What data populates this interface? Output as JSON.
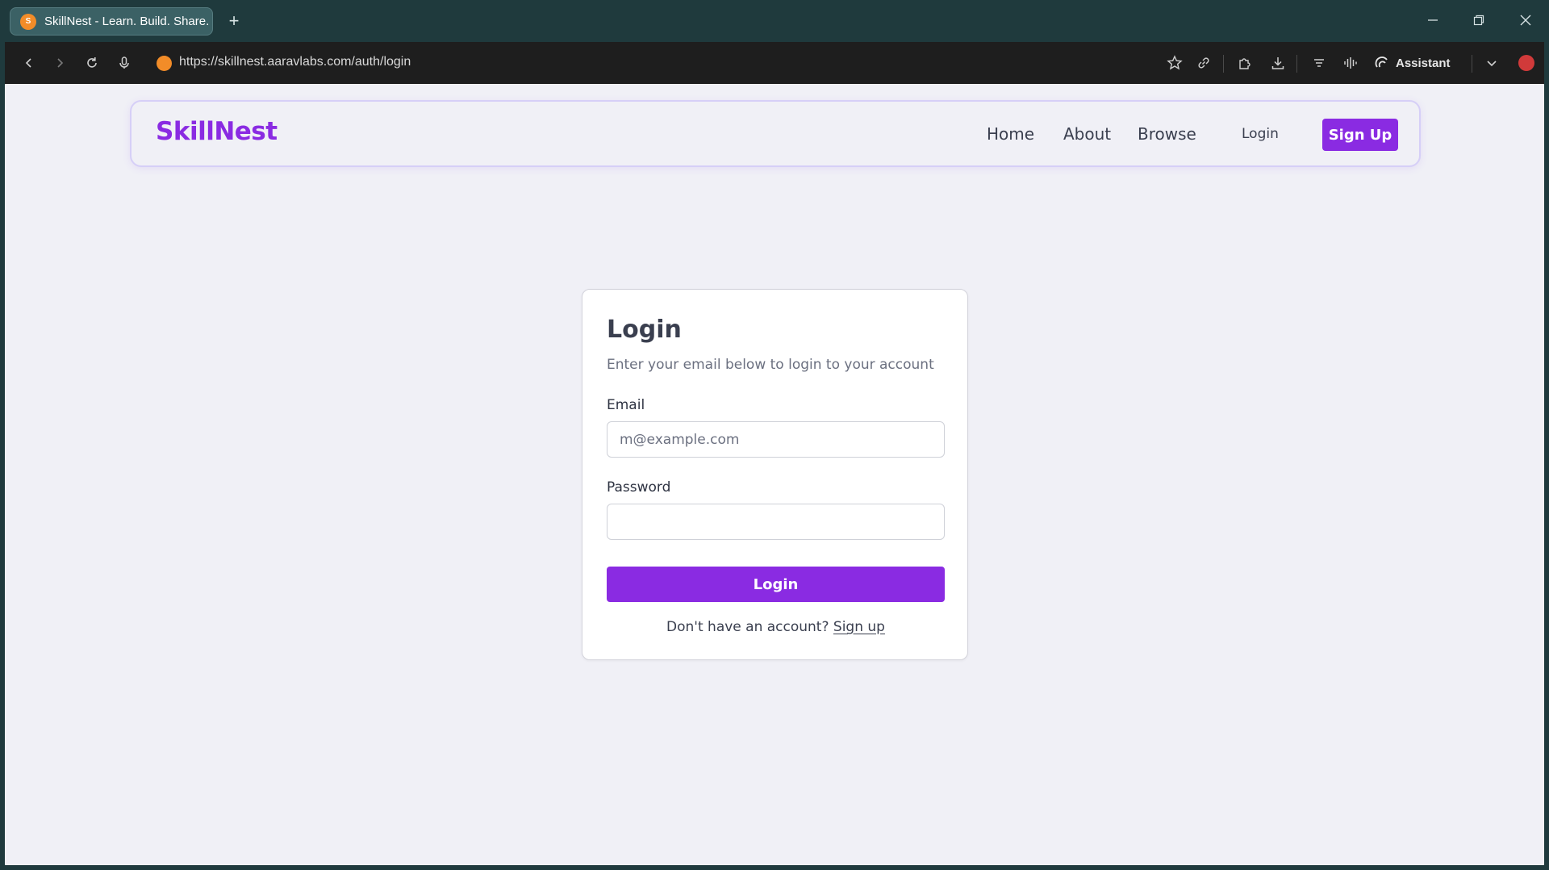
{
  "browser": {
    "tab_title": "SkillNest - Learn. Build. Share.",
    "favicon_letter": "S",
    "url": "https://skillnest.aaravlabs.com/auth/login",
    "assistant_label": "Assistant"
  },
  "site": {
    "brand": "SkillNest",
    "nav": {
      "home": "Home",
      "about": "About",
      "browse": "Browse",
      "login": "Login",
      "signup": "Sign Up"
    }
  },
  "login_card": {
    "title": "Login",
    "subtitle": "Enter your email below to login to your account",
    "email_label": "Email",
    "email_placeholder": "m@example.com",
    "email_value": "",
    "password_label": "Password",
    "password_value": "",
    "submit_label": "Login",
    "footer_prompt": "Don't have an account?",
    "footer_link": "Sign up"
  },
  "colors": {
    "accent": "#8a2be2",
    "page_bg": "#f0f0f6",
    "chrome_bg": "#1f3a3d",
    "favicon": "#f28c28"
  }
}
